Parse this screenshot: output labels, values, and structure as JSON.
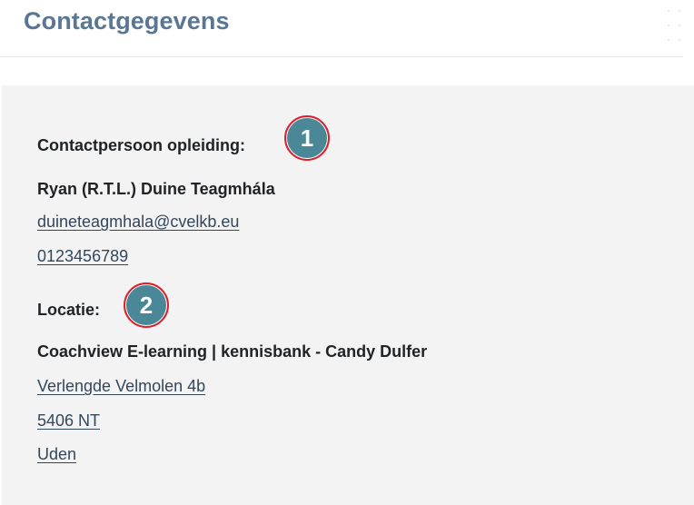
{
  "header": {
    "title": "Contactgegevens",
    "drag_icon": "drag-handle-icon"
  },
  "contact": {
    "label": "Contactpersoon opleiding:",
    "name": "Ryan (R.T.L.) Duine Teagmhála",
    "email": "duineteagmhala@cvelkb.eu",
    "phone": "0123456789"
  },
  "location": {
    "label": "Locatie:",
    "name": "Coachview E-learning | kennisbank - Candy Dulfer",
    "street": "Verlengde Velmolen 4b",
    "postcode": "5406 NT",
    "city": "Uden"
  },
  "markers": [
    {
      "number": "1"
    },
    {
      "number": "2"
    }
  ],
  "colors": {
    "title": "#5a7695",
    "panel_background": "#f3f3f3",
    "marker_fill": "#4a8898",
    "marker_border": "#e11d2a"
  }
}
